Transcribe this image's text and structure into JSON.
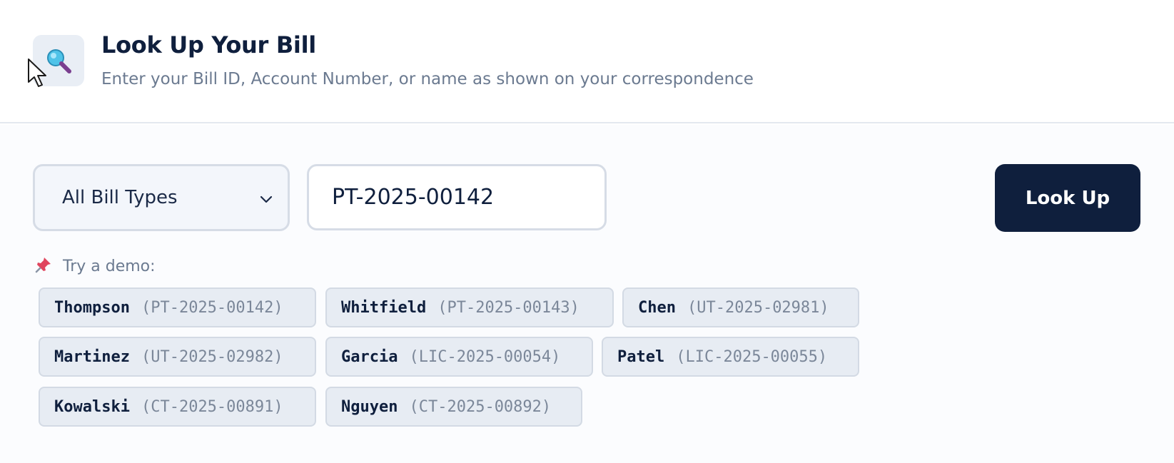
{
  "header": {
    "icon": "magnifier-icon",
    "title": "Look Up Your Bill",
    "subtitle": "Enter your Bill ID, Account Number, or name as shown on your correspondence"
  },
  "form": {
    "bill_type_select": {
      "selected": "All Bill Types"
    },
    "search": {
      "value": "PT-2025-00142"
    },
    "lookup_label": "Look Up"
  },
  "demo": {
    "icon": "pushpin-icon",
    "label": "Try a demo:",
    "chips": [
      {
        "name": "Thompson",
        "id": "(PT-2025-00142)"
      },
      {
        "name": "Whitfield",
        "id": "(PT-2025-00143)"
      },
      {
        "name": "Chen",
        "id": "(UT-2025-02981)"
      },
      {
        "name": "Martinez",
        "id": "(UT-2025-02982)"
      },
      {
        "name": "Garcia",
        "id": "(LIC-2025-00054)"
      },
      {
        "name": "Patel",
        "id": "(LIC-2025-00055)"
      },
      {
        "name": "Kowalski",
        "id": "(CT-2025-00891)"
      },
      {
        "name": "Nguyen",
        "id": "(CT-2025-00892)"
      }
    ]
  },
  "colors": {
    "primary": "#0f1f3d",
    "muted_text": "#6b7a90",
    "chip_bg": "#e7ecf3",
    "border": "#d6dce6"
  }
}
